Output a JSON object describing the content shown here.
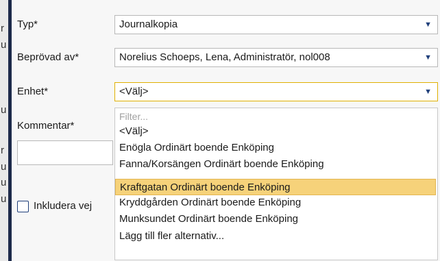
{
  "background_fragments": [
    "r",
    "u",
    "u",
    "r",
    "u",
    "u",
    "u"
  ],
  "form": {
    "typ_label": "Typ*",
    "typ_value": "Journalkopia",
    "beprovad_label": "Beprövad av*",
    "beprovad_value": "Norelius Schoeps, Lena, Administratör, nol008",
    "enhet_label": "Enhet*",
    "enhet_value": "<Välj>",
    "kommentar_label": "Kommentar*",
    "include_label": "Inkludera vej"
  },
  "dropdown": {
    "filter_placeholder": "Filter...",
    "options": [
      "<Välj>",
      "Enögla Ordinärt boende Enköping",
      "Fanna/Korsängen Ordinärt boende Enköping",
      "Kraftgatan Ordinärt boende Enköping",
      "Kryddgården Ordinärt boende Enköping",
      "Munksundet Ordinärt boende Enköping",
      "Lägg till fler alternativ..."
    ],
    "highlighted_index": 3
  },
  "icons": {
    "dropdown_arrow": "▼"
  },
  "colors": {
    "divider": "#1d2a4a",
    "highlight": "#f6d27a",
    "arrow": "#1f3f7a"
  }
}
